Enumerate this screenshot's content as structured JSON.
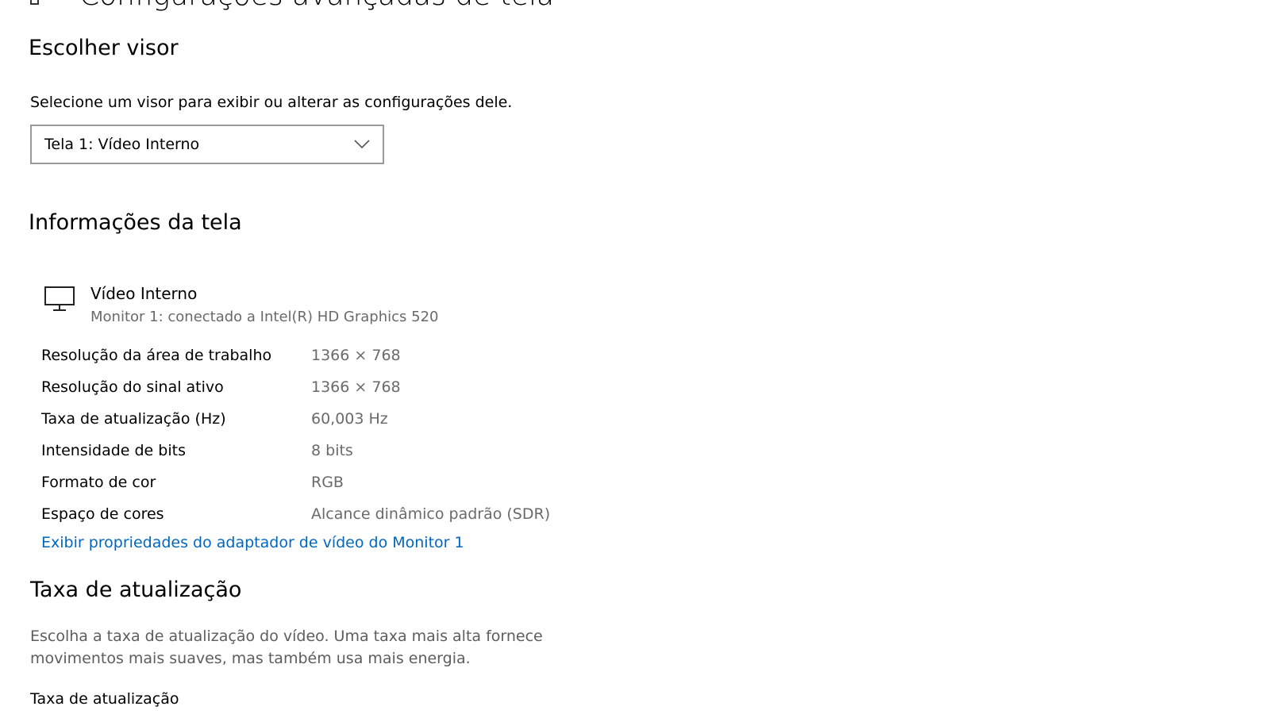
{
  "page": {
    "title": "Configurações avançadas de tela",
    "header_icon": "display-settings-icon"
  },
  "choose_display": {
    "heading": "Escolher visor",
    "description": "Selecione um visor para exibir ou alterar as configurações dele.",
    "selected": "Tela 1: Vídeo Interno",
    "chevron_icon": "chevron-down-icon"
  },
  "display_info": {
    "heading": "Informações da tela",
    "monitor_icon": "monitor-icon",
    "monitor_name": "Vídeo Interno",
    "monitor_subtitle": "Monitor 1: conectado a Intel(R) HD Graphics 520",
    "rows": [
      {
        "label": "Resolução da área de trabalho",
        "value": "1366 × 768"
      },
      {
        "label": "Resolução do sinal ativo",
        "value": "1366 × 768"
      },
      {
        "label": "Taxa de atualização (Hz)",
        "value": "60,003 Hz"
      },
      {
        "label": "Intensidade de bits",
        "value": "8 bits"
      },
      {
        "label": "Formato de cor",
        "value": "RGB"
      },
      {
        "label": "Espaço de cores",
        "value": "Alcance dinâmico padrão (SDR)"
      }
    ],
    "adapter_link": "Exibir propriedades do adaptador de vídeo do Monitor 1"
  },
  "refresh_rate": {
    "heading": "Taxa de atualização",
    "description": "Escolha a taxa de atualização do vídeo. Uma taxa mais alta fornece movimentos mais suaves, mas também usa mais energia.",
    "field_label": "Taxa de atualização"
  },
  "colors": {
    "link": "#0067c0",
    "muted_text": "#6a6a6a",
    "border": "#999999"
  }
}
